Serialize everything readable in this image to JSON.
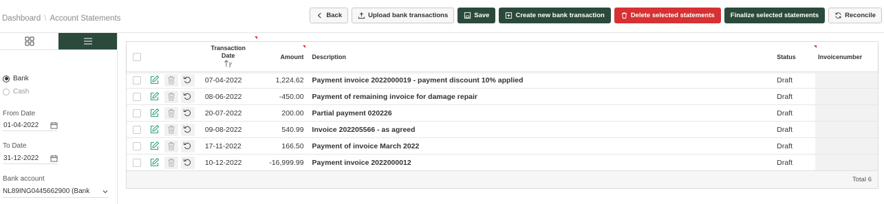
{
  "breadcrumb": {
    "root": "Dashboard",
    "separator": "\\",
    "current": "Account Statements"
  },
  "toolbar": {
    "back": "Back",
    "upload": "Upload bank transactions",
    "save": "Save",
    "create": "Create new bank transaction",
    "delete": "Delete selected statements",
    "finalize": "Finalize selected statements",
    "reconcile": "Reconcile"
  },
  "colors": {
    "primary": "#2b4a3c",
    "danger": "#d63133",
    "edit": "#2e9e7e"
  },
  "sidebar": {
    "source_options": [
      {
        "label": "Bank",
        "selected": true
      },
      {
        "label": "Cash",
        "selected": false
      }
    ],
    "from_date_label": "From Date",
    "from_date": "01-04-2022",
    "to_date_label": "To Date",
    "to_date": "31-12-2022",
    "bank_account_label": "Bank account",
    "bank_account": "NL89ING0445662900 (Bank"
  },
  "table": {
    "headers": {
      "date_line1": "Transaction",
      "date_line2": "Date",
      "amount": "Amount",
      "description": "Description",
      "status": "Status",
      "invoice": "Invoicenumber"
    },
    "rows": [
      {
        "date": "07-04-2022",
        "amount": "1,224.62",
        "description": "Payment invoice 2022000019 - payment discount 10% applied",
        "status": "Draft"
      },
      {
        "date": "08-06-2022",
        "amount": "-450.00",
        "description": "Payment of remaining invoice for damage repair",
        "status": "Draft"
      },
      {
        "date": "20-07-2022",
        "amount": "200.00",
        "description": "Partial payment 020226",
        "status": "Draft"
      },
      {
        "date": "09-08-2022",
        "amount": "540.99",
        "description": "Invoice 202205566 - as agreed",
        "status": "Draft"
      },
      {
        "date": "17-11-2022",
        "amount": "166.50",
        "description": "Payment of invoice March 2022",
        "status": "Draft"
      },
      {
        "date": "10-12-2022",
        "amount": "-16,999.99",
        "description": "Payment invoice 2022000012",
        "status": "Draft"
      }
    ],
    "footer_total": "Total 6"
  }
}
